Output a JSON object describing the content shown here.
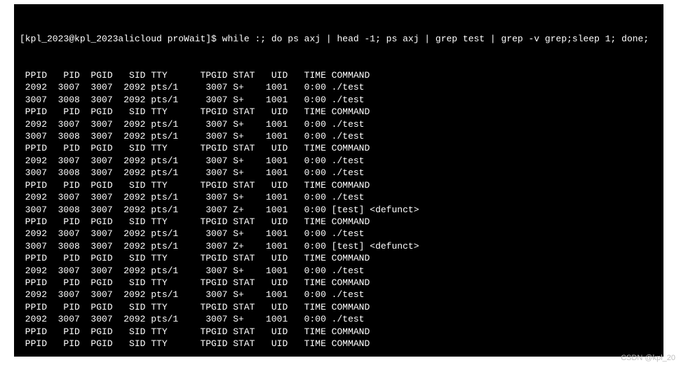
{
  "prompt": "[kpl_2023@kpl_2023alicloud proWait]$ while :; do ps axj | head -1; ps axj | grep test | grep -v grep;sleep 1; done;",
  "header_cols": [
    " PPID",
    "   PID",
    "  PGID",
    "   SID",
    " TTY   ",
    "   TPGID",
    " STAT",
    "   UID",
    "   TIME",
    " COMMAND"
  ],
  "rows": [
    {
      "t": "h"
    },
    {
      "t": "d",
      "c": [
        " 2092",
        "  3007",
        "  3007",
        "  2092",
        " pts/1 ",
        "    3007",
        " S+  ",
        "  1001",
        "   0:00",
        " ./test"
      ]
    },
    {
      "t": "d",
      "c": [
        " 3007",
        "  3008",
        "  3007",
        "  2092",
        " pts/1 ",
        "    3007",
        " S+  ",
        "  1001",
        "   0:00",
        " ./test"
      ]
    },
    {
      "t": "h"
    },
    {
      "t": "d",
      "c": [
        " 2092",
        "  3007",
        "  3007",
        "  2092",
        " pts/1 ",
        "    3007",
        " S+  ",
        "  1001",
        "   0:00",
        " ./test"
      ]
    },
    {
      "t": "d",
      "c": [
        " 3007",
        "  3008",
        "  3007",
        "  2092",
        " pts/1 ",
        "    3007",
        " S+  ",
        "  1001",
        "   0:00",
        " ./test"
      ]
    },
    {
      "t": "h"
    },
    {
      "t": "d",
      "c": [
        " 2092",
        "  3007",
        "  3007",
        "  2092",
        " pts/1 ",
        "    3007",
        " S+  ",
        "  1001",
        "   0:00",
        " ./test"
      ]
    },
    {
      "t": "d",
      "c": [
        " 3007",
        "  3008",
        "  3007",
        "  2092",
        " pts/1 ",
        "    3007",
        " S+  ",
        "  1001",
        "   0:00",
        " ./test"
      ]
    },
    {
      "t": "h"
    },
    {
      "t": "d",
      "c": [
        " 2092",
        "  3007",
        "  3007",
        "  2092",
        " pts/1 ",
        "    3007",
        " S+  ",
        "  1001",
        "   0:00",
        " ./test"
      ]
    },
    {
      "t": "d",
      "c": [
        " 3007",
        "  3008",
        "  3007",
        "  2092",
        " pts/1 ",
        "    3007",
        " Z+  ",
        "  1001",
        "   0:00",
        " [test] <defunct>"
      ]
    },
    {
      "t": "h"
    },
    {
      "t": "d",
      "c": [
        " 2092",
        "  3007",
        "  3007",
        "  2092",
        " pts/1 ",
        "    3007",
        " S+  ",
        "  1001",
        "   0:00",
        " ./test"
      ]
    },
    {
      "t": "d",
      "c": [
        " 3007",
        "  3008",
        "  3007",
        "  2092",
        " pts/1 ",
        "    3007",
        " Z+  ",
        "  1001",
        "   0:00",
        " [test] <defunct>"
      ]
    },
    {
      "t": "h"
    },
    {
      "t": "d",
      "c": [
        " 2092",
        "  3007",
        "  3007",
        "  2092",
        " pts/1 ",
        "    3007",
        " S+  ",
        "  1001",
        "   0:00",
        " ./test"
      ]
    },
    {
      "t": "h"
    },
    {
      "t": "d",
      "c": [
        " 2092",
        "  3007",
        "  3007",
        "  2092",
        " pts/1 ",
        "    3007",
        " S+  ",
        "  1001",
        "   0:00",
        " ./test"
      ]
    },
    {
      "t": "h"
    },
    {
      "t": "d",
      "c": [
        " 2092",
        "  3007",
        "  3007",
        "  2092",
        " pts/1 ",
        "    3007",
        " S+  ",
        "  1001",
        "   0:00",
        " ./test"
      ]
    },
    {
      "t": "h"
    },
    {
      "t": "h"
    }
  ],
  "watermark": "CSDN @kpl_20"
}
